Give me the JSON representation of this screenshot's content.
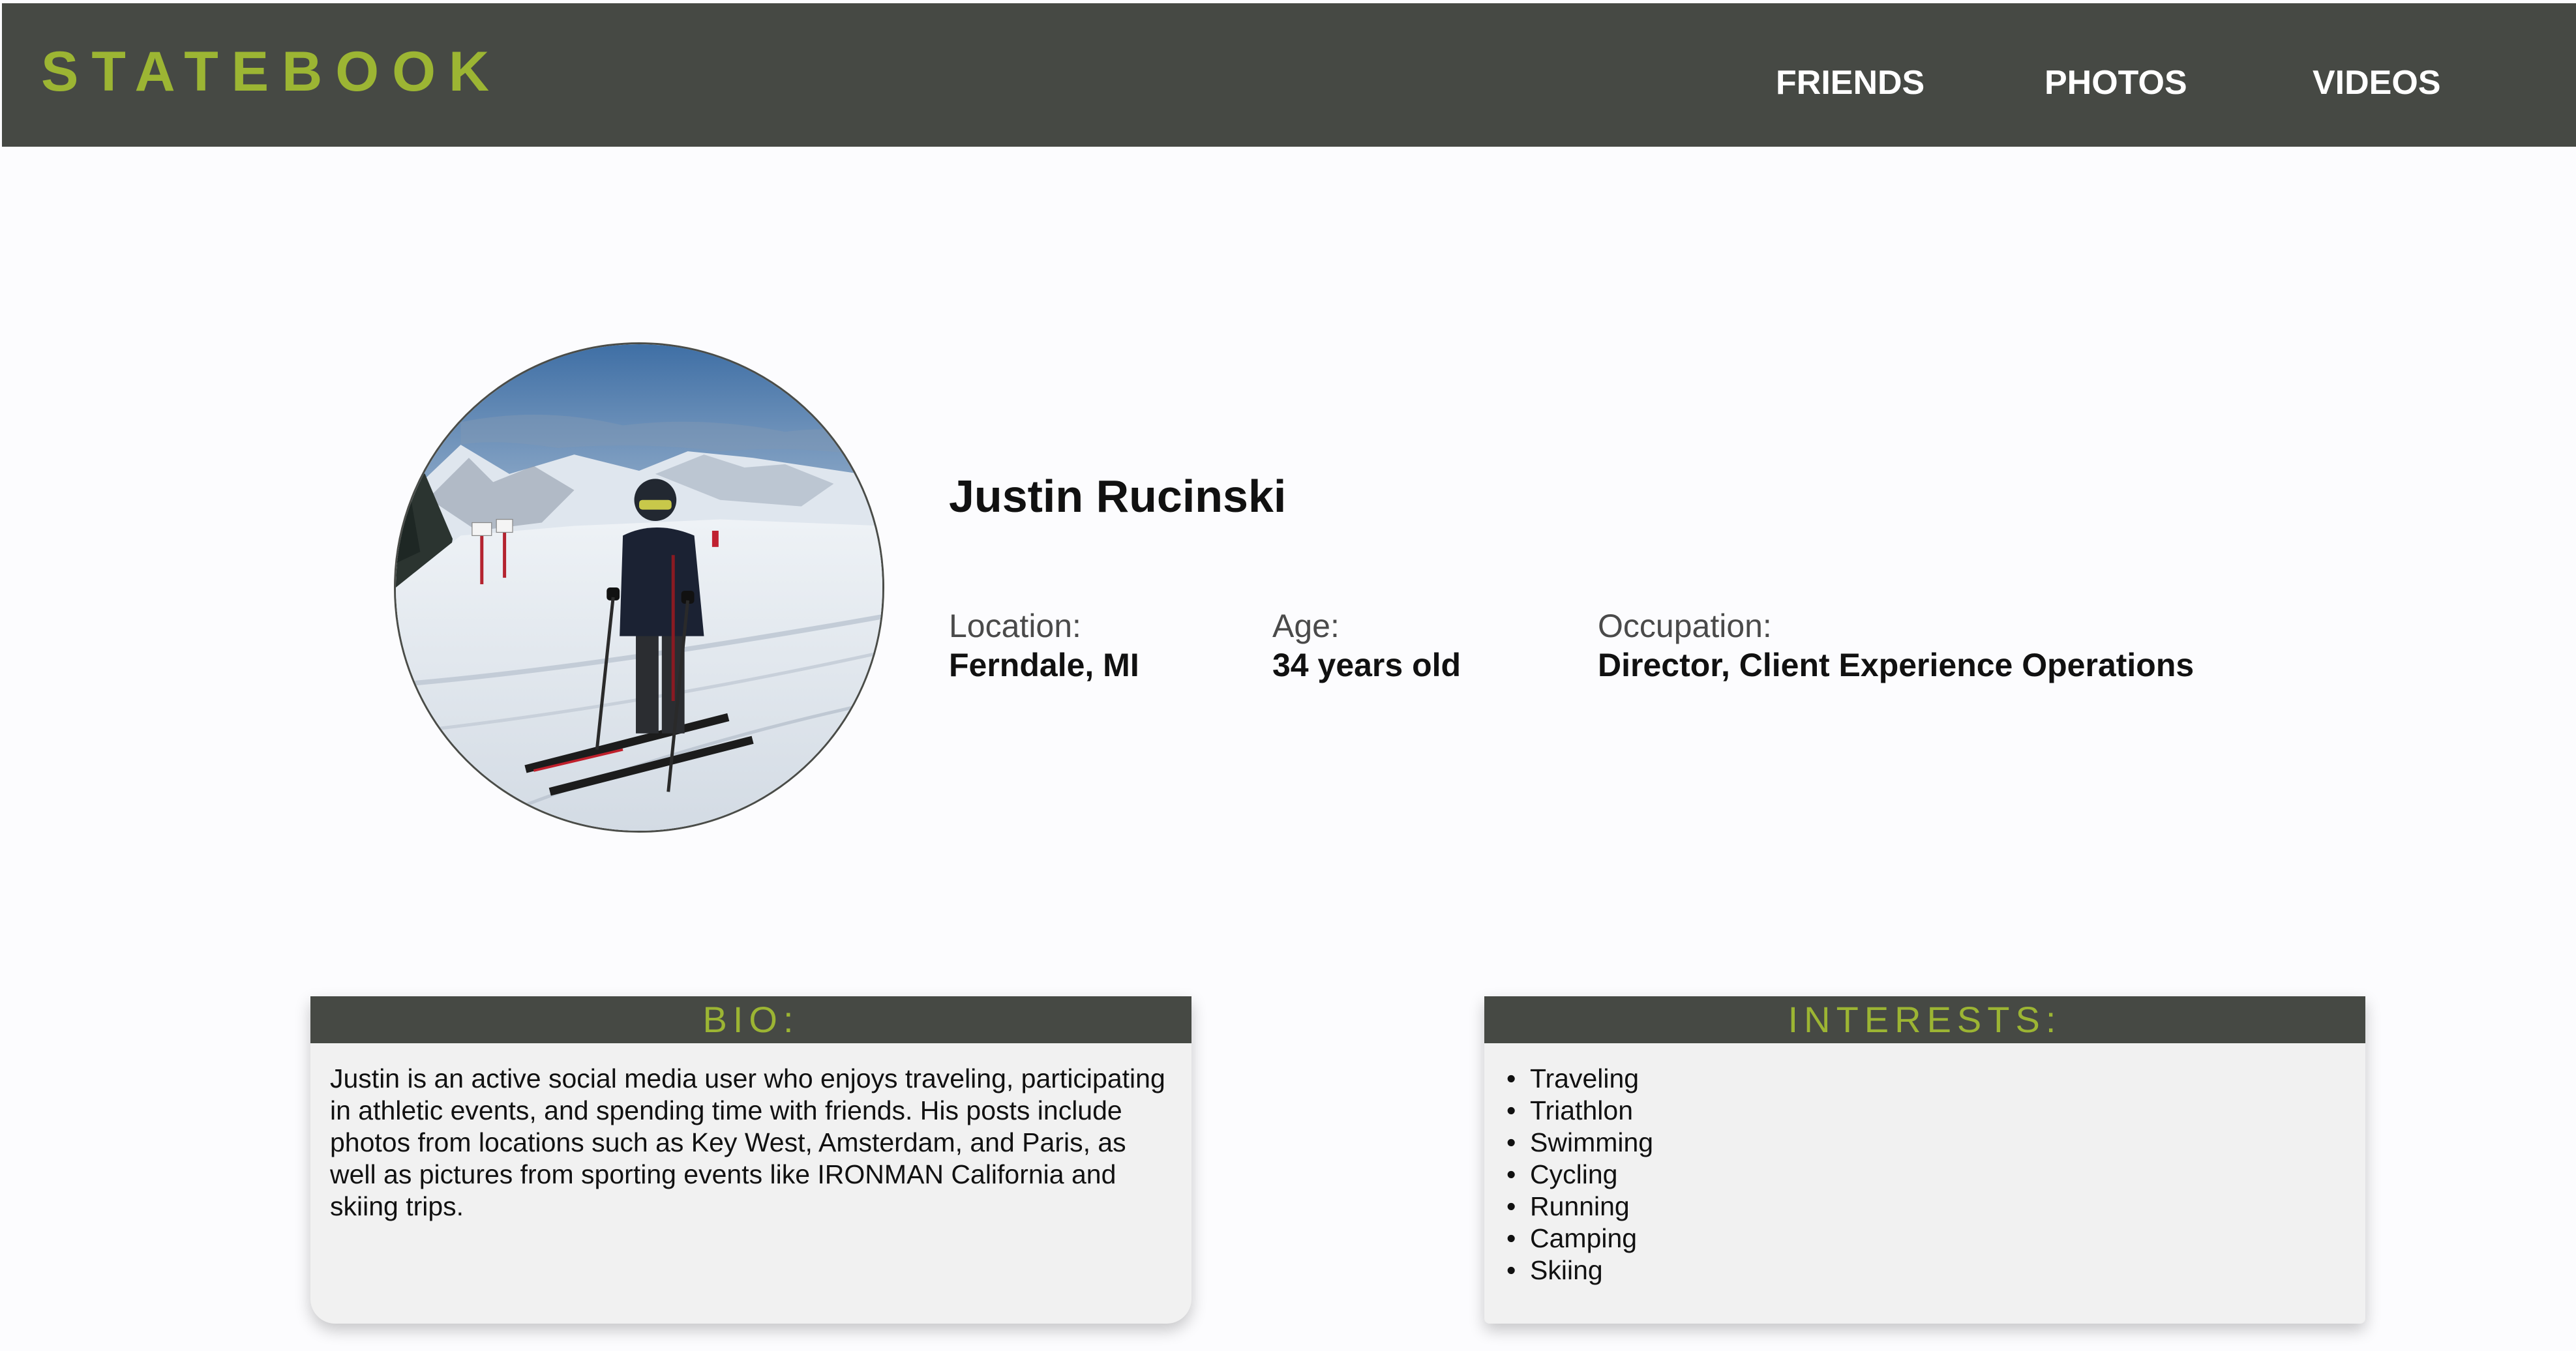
{
  "header": {
    "brand": "STATEBOOK",
    "nav": [
      "FRIENDS",
      "PHOTOS",
      "VIDEOS"
    ]
  },
  "colors": {
    "header_bg": "#464944",
    "accent": "#9cb533",
    "page_bg": "#fcfcfe",
    "card_bg": "#f1f1f1"
  },
  "profile": {
    "photo_icon": "profile-photo-skier",
    "name": "Justin Rucinski",
    "location_label": "Location:",
    "location": "Ferndale, MI",
    "age_label": "Age:",
    "age": "34 years old",
    "occupation_label": "Occupation:",
    "occupation": "Director, Client Experience Operations"
  },
  "bio": {
    "heading": "BIO:",
    "text": "Justin is an active social media user who enjoys traveling, participating in athletic events, and spending time with friends. His posts include photos from locations such as Key West, Amsterdam, and Paris, as well as pictures from sporting events like IRONMAN California and skiing trips."
  },
  "interests": {
    "heading": "INTERESTS:",
    "bullet": "•",
    "items": [
      "Traveling",
      "Triathlon",
      "Swimming",
      "Cycling",
      "Running",
      "Camping",
      "Skiing"
    ]
  }
}
